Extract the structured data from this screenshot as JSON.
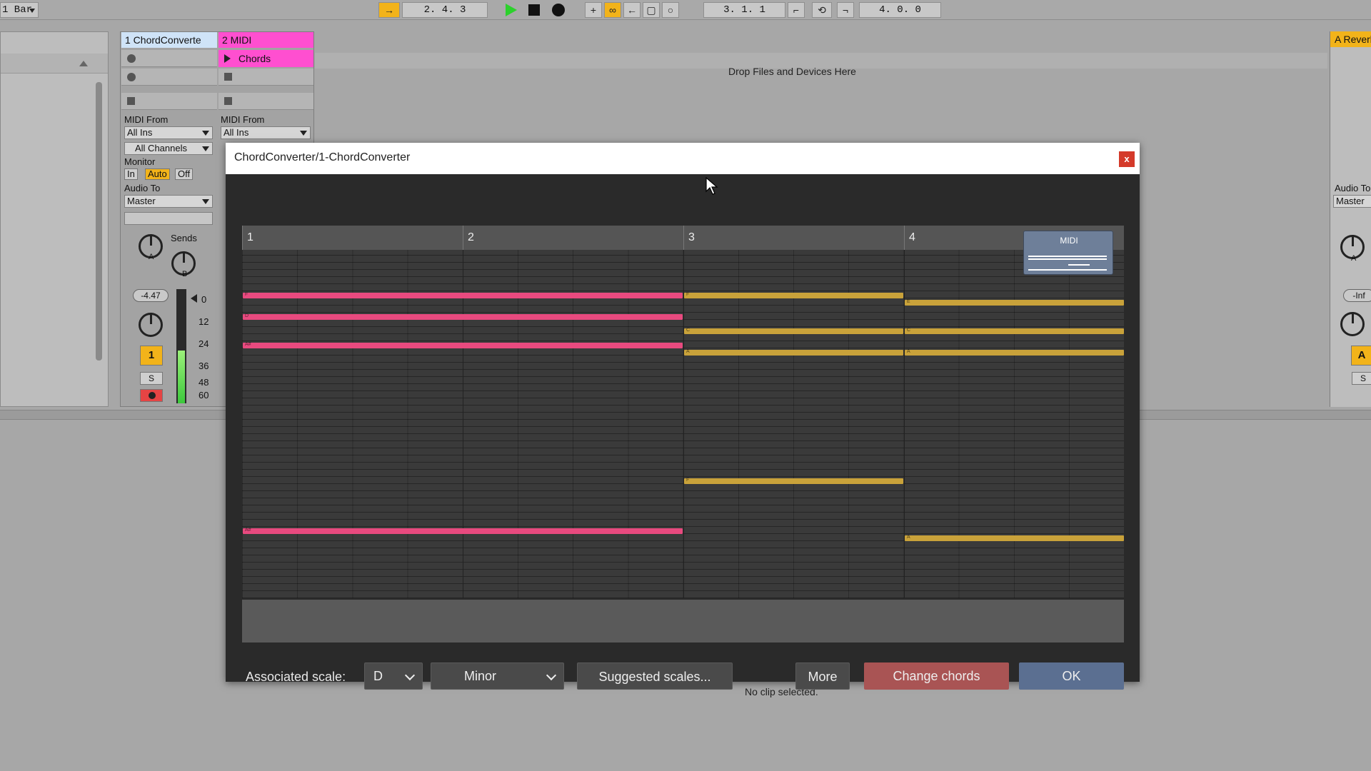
{
  "transport": {
    "quantize": "1 Bar",
    "position": "2.  4.  3",
    "loop_start": "3.  1.  1",
    "loop_length": "4.  0.  0"
  },
  "tracks": [
    {
      "name": "1 ChordConverte",
      "color": "#cfe3f7",
      "midi_from_label": "MIDI From",
      "midi_from": "All Ins",
      "channel": "All Channels",
      "monitor_label": "Monitor",
      "monitor_in": "In",
      "monitor_auto": "Auto",
      "monitor_off": "Off",
      "audio_to_label": "Audio To",
      "audio_to": "Master",
      "sends_label": "Sends",
      "send_a": "A",
      "send_b": "B",
      "volume": "-4.47",
      "number": "1",
      "solo": "S",
      "meter_scale": [
        "0",
        "12",
        "24",
        "36",
        "48",
        "60"
      ]
    },
    {
      "name": "2 MIDI",
      "color": "#ff4fd0",
      "clip_name": "Chords",
      "midi_from_label": "MIDI From",
      "midi_from": "All Ins"
    }
  ],
  "drop_zone_text": "Drop Files and Devices Here",
  "return_track": {
    "name": "A Reverb",
    "audio_to_label": "Audio To",
    "audio_to": "Master",
    "volume": "-Inf",
    "button": "A",
    "solo": "S",
    "send_label": "A"
  },
  "status_text": "No clip selected.",
  "dialog": {
    "title": "ChordConverter/1-ChordConverter",
    "close_label": "x",
    "ruler": [
      "1",
      "2",
      "3",
      "4"
    ],
    "midi_thumb_label": "MIDI",
    "colors": {
      "pink": "#e84a7f",
      "yellow": "#c9a23a"
    },
    "notes": [
      {
        "color": "pink",
        "start": 0,
        "end": 2,
        "row": 5,
        "label": "F"
      },
      {
        "color": "pink",
        "start": 0,
        "end": 2,
        "row": 8,
        "label": "D"
      },
      {
        "color": "pink",
        "start": 0,
        "end": 2,
        "row": 12,
        "label": "A#"
      },
      {
        "color": "pink",
        "start": 0,
        "end": 2,
        "row": 38,
        "label": "A#"
      },
      {
        "color": "yellow",
        "start": 2,
        "end": 3,
        "row": 5,
        "label": "F"
      },
      {
        "color": "yellow",
        "start": 3,
        "end": 4,
        "row": 6,
        "label": "E"
      },
      {
        "color": "yellow",
        "start": 2,
        "end": 3,
        "row": 10,
        "label": "C"
      },
      {
        "color": "yellow",
        "start": 3,
        "end": 4,
        "row": 10,
        "label": "C"
      },
      {
        "color": "yellow",
        "start": 2,
        "end": 3,
        "row": 13,
        "label": "A"
      },
      {
        "color": "yellow",
        "start": 3,
        "end": 4,
        "row": 13,
        "label": "A"
      },
      {
        "color": "yellow",
        "start": 2,
        "end": 3,
        "row": 31,
        "label": "F"
      },
      {
        "color": "yellow",
        "start": 3,
        "end": 4,
        "row": 39,
        "label": "A"
      }
    ],
    "associated_scale_label": "Associated scale:",
    "scale_root": "D",
    "scale_type": "Minor",
    "suggested_label": "Suggested scales...",
    "more_label": "More",
    "change_chords_label": "Change chords",
    "ok_label": "OK"
  }
}
